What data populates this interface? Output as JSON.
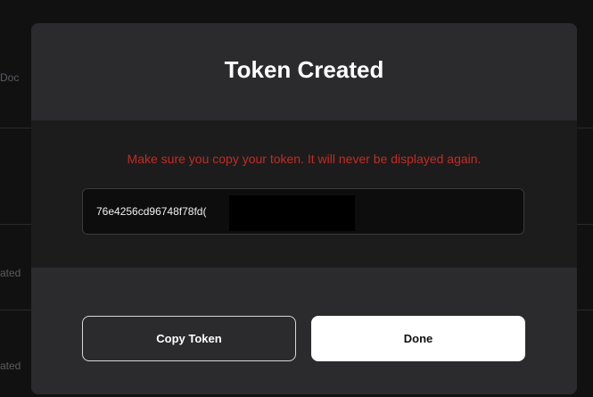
{
  "background": {
    "fragments": [
      "Doc",
      "ated",
      "ated"
    ]
  },
  "modal": {
    "title": "Token Created",
    "warning": "Make sure you copy your token. It will never be displayed again.",
    "token_value": "76e4256cd96748f78fd(",
    "buttons": {
      "copy_label": "Copy Token",
      "done_label": "Done"
    }
  },
  "colors": {
    "warning": "#c42b22",
    "modal_bg": "#2b2b2d",
    "body_bg": "#1c1c1d",
    "field_bg": "#0d0d0e",
    "primary_button": "#ffffff"
  }
}
